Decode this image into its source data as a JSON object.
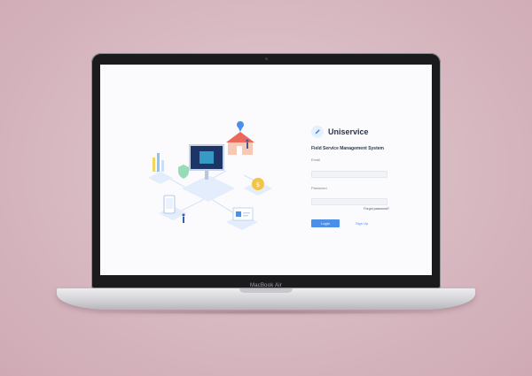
{
  "device": {
    "model_label": "MacBook Air"
  },
  "app": {
    "brand_name": "Uniservice",
    "subtitle": "Field Service Management System",
    "logo_icon": "pencil-icon",
    "accent_color": "#4a90e8"
  },
  "form": {
    "email_label": "Email",
    "email_value": "",
    "password_label": "Password",
    "password_value": "",
    "forgot_label": "Forgot password?",
    "login_label": "Login",
    "signup_label": "Sign Up"
  },
  "illustration": {
    "icons": [
      "house-icon",
      "monitor-icon",
      "location-pin-icon",
      "phone-icon",
      "coin-icon",
      "checklist-icon"
    ]
  }
}
